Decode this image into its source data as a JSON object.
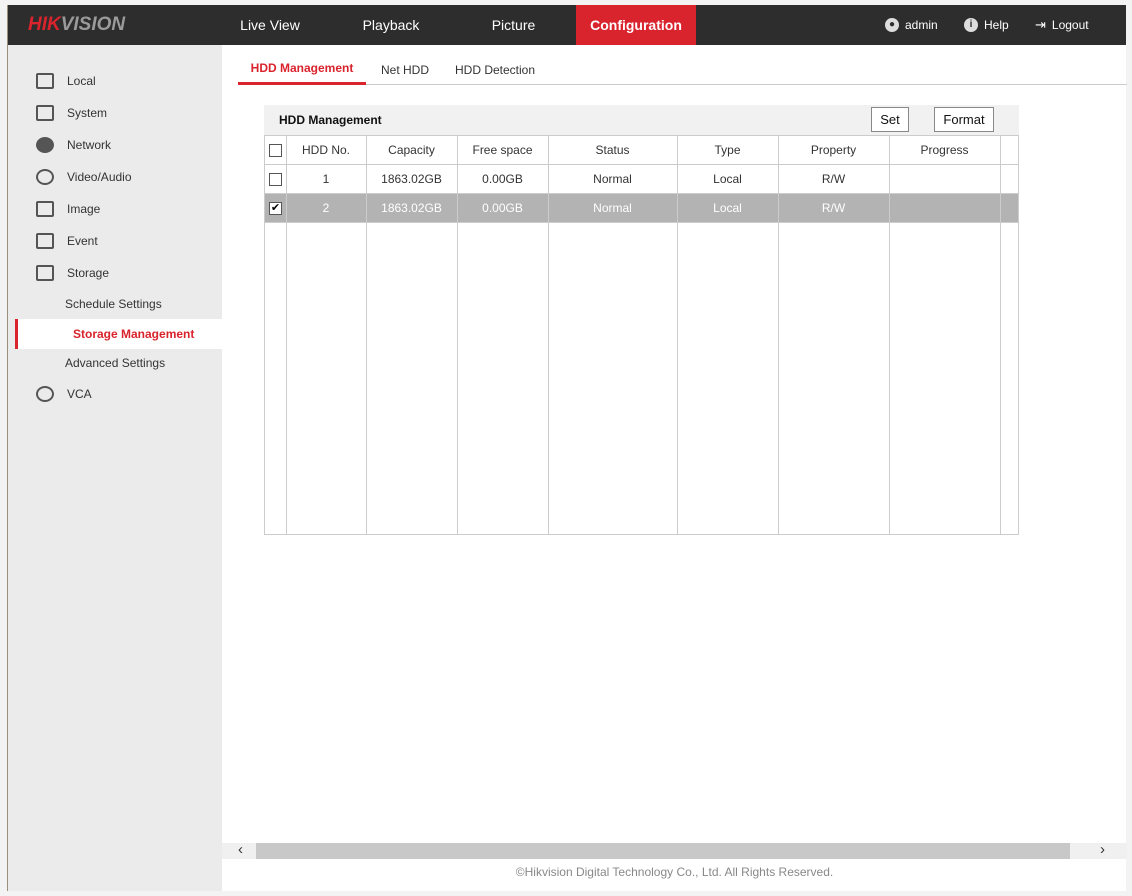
{
  "header": {
    "logo": "HIKVISION",
    "nav": [
      "Live View",
      "Playback",
      "Picture",
      "Configuration"
    ],
    "active_nav": "Configuration",
    "user": "admin",
    "help": "Help",
    "logout": "Logout"
  },
  "sidebar": {
    "items": [
      {
        "label": "Local",
        "icon": "monitor-icon"
      },
      {
        "label": "System",
        "icon": "window-icon"
      },
      {
        "label": "Network",
        "icon": "globe-icon"
      },
      {
        "label": "Video/Audio",
        "icon": "microphone-icon"
      },
      {
        "label": "Image",
        "icon": "image-icon"
      },
      {
        "label": "Event",
        "icon": "calendar-icon"
      },
      {
        "label": "Storage",
        "icon": "floppy-icon"
      }
    ],
    "storage_sub": [
      "Schedule Settings",
      "Storage Management",
      "Advanced Settings"
    ],
    "active_sub": "Storage Management",
    "vca": "VCA"
  },
  "tabs": [
    "HDD Management",
    "Net HDD",
    "HDD Detection"
  ],
  "panel": {
    "title": "HDD Management",
    "set": "Set",
    "format": "Format"
  },
  "table": {
    "columns": [
      "HDD No.",
      "Capacity",
      "Free space",
      "Status",
      "Type",
      "Property",
      "Progress"
    ],
    "rows": [
      {
        "checked": false,
        "cells": [
          "1",
          "1863.02GB",
          "0.00GB",
          "Normal",
          "Local",
          "R/W",
          ""
        ]
      },
      {
        "checked": true,
        "cells": [
          "2",
          "1863.02GB",
          "0.00GB",
          "Normal",
          "Local",
          "R/W",
          ""
        ]
      }
    ]
  },
  "footer": "©Hikvision Digital Technology Co., Ltd. All Rights Reserved.",
  "colors": {
    "accent": "#d9232d",
    "topbar": "#2d2d2d",
    "selected_row": "#b3b3b3"
  }
}
